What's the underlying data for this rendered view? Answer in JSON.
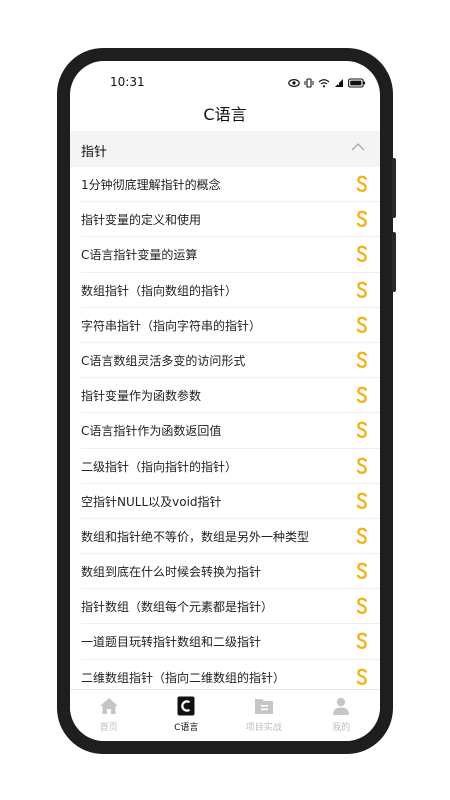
{
  "status_bar": {
    "time": "10:31",
    "icons": [
      "eye-icon",
      "vibrate-icon",
      "wifi-icon",
      "signal-icon",
      "battery-icon"
    ]
  },
  "header": {
    "title": "C语言"
  },
  "section": {
    "label": "指针",
    "expanded": true
  },
  "badge_color": "#f0b419",
  "items": [
    {
      "label": "1分钟彻底理解指针的概念"
    },
    {
      "label": "指针变量的定义和使用"
    },
    {
      "label": "C语言指针变量的运算"
    },
    {
      "label": "数组指针（指向数组的指针）"
    },
    {
      "label": "字符串指针（指向字符串的指针）"
    },
    {
      "label": "C语言数组灵活多变的访问形式"
    },
    {
      "label": "指针变量作为函数参数"
    },
    {
      "label": "C语言指针作为函数返回值"
    },
    {
      "label": "二级指针（指向指针的指针）"
    },
    {
      "label": "空指针NULL以及void指针"
    },
    {
      "label": "数组和指针绝不等价，数组是另外一种类型"
    },
    {
      "label": "数组到底在什么时候会转换为指针"
    },
    {
      "label": "指针数组（数组每个元素都是指针）"
    },
    {
      "label": "一道题目玩转指针数组和二级指针"
    },
    {
      "label": "二维数组指针（指向二维数组的指针）"
    }
  ],
  "tabbar": {
    "tabs": [
      {
        "label": "首页",
        "icon": "home-icon",
        "active": false
      },
      {
        "label": "C语言",
        "icon": "c-language-icon",
        "active": true
      },
      {
        "label": "项目实战",
        "icon": "project-icon",
        "active": false
      },
      {
        "label": "我的",
        "icon": "user-icon",
        "active": false
      }
    ]
  }
}
